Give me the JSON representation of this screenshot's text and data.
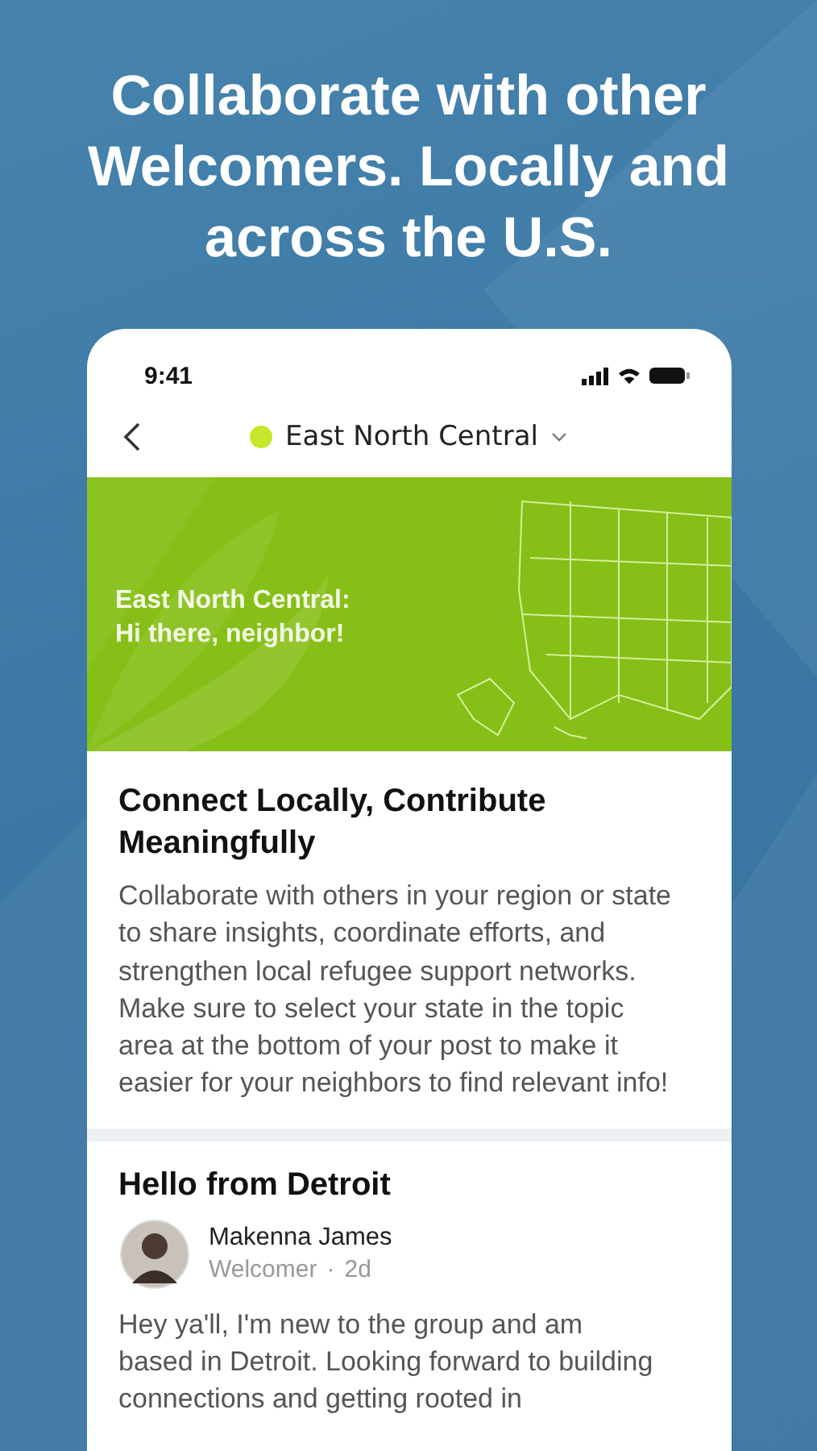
{
  "headline": "Collaborate with other Welcomers. Locally and across the U.S.",
  "status_bar": {
    "time": "9:41"
  },
  "nav": {
    "title": "East North Central",
    "color": "#c6e82a"
  },
  "banner": {
    "lines": [
      "East North Central:",
      "Hi there, neighbor!"
    ]
  },
  "intro": {
    "title": "Connect Locally, Contribute Meaningfully",
    "body": "Collaborate with others in your region or state to share insights, coordinate efforts, and strengthen local refugee support networks. Make sure to select your state in the topic area at the bottom of your post to make it easier for your neighbors to find relevant info!"
  },
  "post": {
    "title": "Hello from Detroit",
    "author": "Makenna James",
    "role": "Welcomer",
    "separator": "·",
    "time": "2d",
    "body": "Hey ya'll, I'm new to the group and am based in Detroit. Looking forward to building connections and getting rooted in"
  }
}
